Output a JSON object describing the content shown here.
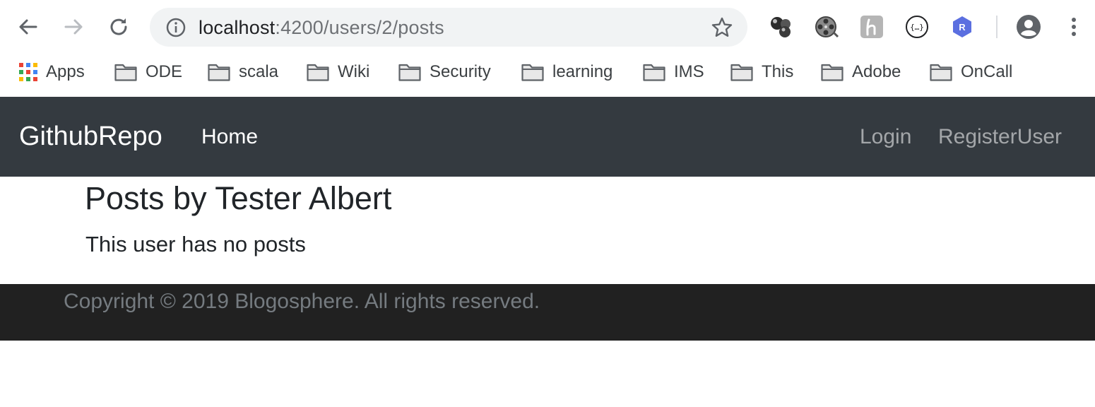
{
  "browser": {
    "url_host": "localhost",
    "url_rest": ":4200/users/2/posts",
    "extensions": [
      "molecule-icon",
      "film-reel-icon",
      "h-extension-icon",
      "json-braces-icon",
      "r-extension-icon"
    ],
    "ext_r_letter": "R"
  },
  "bookmarks": {
    "apps_label": "Apps",
    "folders": [
      "ODE",
      "scala",
      "Wiki",
      "Security",
      "learning",
      "IMS",
      "This",
      "Adobe",
      "OnCall"
    ]
  },
  "navbar": {
    "brand": "GithubRepo",
    "home": "Home",
    "login": "Login",
    "register": "RegisterUser"
  },
  "content": {
    "heading": "Posts by Tester Albert",
    "empty_message": "This user has no posts"
  },
  "footer": {
    "text": "Copyright © 2019 Blogosphere. All rights reserved."
  },
  "colors": {
    "navbar_bg": "#343a40",
    "footer_bg": "#212121",
    "omnibox_bg": "#f1f3f4",
    "text_dark": "#212529"
  }
}
